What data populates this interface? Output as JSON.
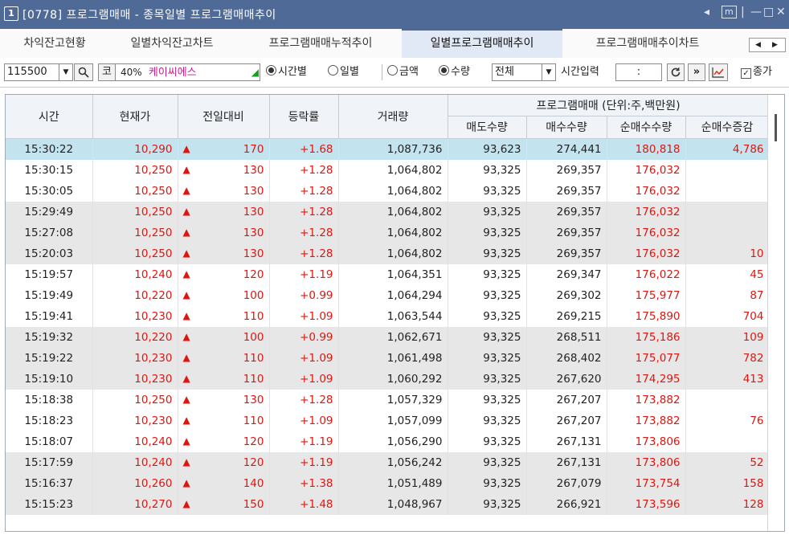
{
  "window": {
    "number": "1",
    "title": "[0778] 프로그램매매 - 종목일별 프로그램매매추이",
    "controls": [
      "◂",
      "m",
      "|",
      "—",
      "□",
      "✕"
    ]
  },
  "tabs": [
    {
      "label": "차익잔고현황",
      "active": false
    },
    {
      "label": "일별차익잔고차트",
      "active": false
    },
    {
      "label": "프로그램매매누적추이",
      "active": false
    },
    {
      "label": "일별프로그램매매추이",
      "active": true
    },
    {
      "label": "프로그램매매추이차트",
      "active": false
    }
  ],
  "tab_scroll": {
    "left": "◀",
    "right": "▶"
  },
  "toolbar": {
    "code": "115500",
    "market": "코",
    "ratio": "40%",
    "stock_name": "케이씨에스",
    "radio_time": "시간별",
    "radio_daily": "일별",
    "radio_amount": "금액",
    "radio_quantity": "수량",
    "filter": "전체",
    "time_label": "시간입력",
    "time_value": ":",
    "close_price_label": "종가"
  },
  "table": {
    "headers": {
      "time": "시간",
      "price": "현재가",
      "change": "전일대비",
      "rate": "등락률",
      "volume": "거래량",
      "program_group": "프로그램매매 (단위:주,백만원)",
      "sell_qty": "매도수량",
      "buy_qty": "매수수량",
      "net_qty": "순매수수량",
      "net_change": "순매수증감"
    },
    "rows": [
      {
        "time": "15:30:22",
        "price": "10,290",
        "arrow": "▲",
        "change": "170",
        "rate": "+1.68",
        "volume": "1,087,736",
        "sell": "93,623",
        "buy": "274,441",
        "net": "180,818",
        "delta": "4,786",
        "style": "sel"
      },
      {
        "time": "15:30:15",
        "price": "10,250",
        "arrow": "▲",
        "change": "130",
        "rate": "+1.28",
        "volume": "1,064,802",
        "sell": "93,325",
        "buy": "269,357",
        "net": "176,032",
        "delta": "",
        "style": "white"
      },
      {
        "time": "15:30:05",
        "price": "10,250",
        "arrow": "▲",
        "change": "130",
        "rate": "+1.28",
        "volume": "1,064,802",
        "sell": "93,325",
        "buy": "269,357",
        "net": "176,032",
        "delta": "",
        "style": "white"
      },
      {
        "time": "15:29:49",
        "price": "10,250",
        "arrow": "▲",
        "change": "130",
        "rate": "+1.28",
        "volume": "1,064,802",
        "sell": "93,325",
        "buy": "269,357",
        "net": "176,032",
        "delta": "",
        "style": "gray"
      },
      {
        "time": "15:27:08",
        "price": "10,250",
        "arrow": "▲",
        "change": "130",
        "rate": "+1.28",
        "volume": "1,064,802",
        "sell": "93,325",
        "buy": "269,357",
        "net": "176,032",
        "delta": "",
        "style": "gray"
      },
      {
        "time": "15:20:03",
        "price": "10,250",
        "arrow": "▲",
        "change": "130",
        "rate": "+1.28",
        "volume": "1,064,802",
        "sell": "93,325",
        "buy": "269,357",
        "net": "176,032",
        "delta": "10",
        "style": "gray"
      },
      {
        "time": "15:19:57",
        "price": "10,240",
        "arrow": "▲",
        "change": "120",
        "rate": "+1.19",
        "volume": "1,064,351",
        "sell": "93,325",
        "buy": "269,347",
        "net": "176,022",
        "delta": "45",
        "style": "white"
      },
      {
        "time": "15:19:49",
        "price": "10,220",
        "arrow": "▲",
        "change": "100",
        "rate": "+0.99",
        "volume": "1,064,294",
        "sell": "93,325",
        "buy": "269,302",
        "net": "175,977",
        "delta": "87",
        "style": "white"
      },
      {
        "time": "15:19:41",
        "price": "10,230",
        "arrow": "▲",
        "change": "110",
        "rate": "+1.09",
        "volume": "1,063,544",
        "sell": "93,325",
        "buy": "269,215",
        "net": "175,890",
        "delta": "704",
        "style": "white"
      },
      {
        "time": "15:19:32",
        "price": "10,220",
        "arrow": "▲",
        "change": "100",
        "rate": "+0.99",
        "volume": "1,062,671",
        "sell": "93,325",
        "buy": "268,511",
        "net": "175,186",
        "delta": "109",
        "style": "gray"
      },
      {
        "time": "15:19:22",
        "price": "10,230",
        "arrow": "▲",
        "change": "110",
        "rate": "+1.09",
        "volume": "1,061,498",
        "sell": "93,325",
        "buy": "268,402",
        "net": "175,077",
        "delta": "782",
        "style": "gray"
      },
      {
        "time": "15:19:10",
        "price": "10,230",
        "arrow": "▲",
        "change": "110",
        "rate": "+1.09",
        "volume": "1,060,292",
        "sell": "93,325",
        "buy": "267,620",
        "net": "174,295",
        "delta": "413",
        "style": "gray"
      },
      {
        "time": "15:18:38",
        "price": "10,250",
        "arrow": "▲",
        "change": "130",
        "rate": "+1.28",
        "volume": "1,057,329",
        "sell": "93,325",
        "buy": "267,207",
        "net": "173,882",
        "delta": "",
        "style": "white"
      },
      {
        "time": "15:18:23",
        "price": "10,230",
        "arrow": "▲",
        "change": "110",
        "rate": "+1.09",
        "volume": "1,057,099",
        "sell": "93,325",
        "buy": "267,207",
        "net": "173,882",
        "delta": "76",
        "style": "white"
      },
      {
        "time": "15:18:07",
        "price": "10,240",
        "arrow": "▲",
        "change": "120",
        "rate": "+1.19",
        "volume": "1,056,290",
        "sell": "93,325",
        "buy": "267,131",
        "net": "173,806",
        "delta": "",
        "style": "white"
      },
      {
        "time": "15:17:59",
        "price": "10,240",
        "arrow": "▲",
        "change": "120",
        "rate": "+1.19",
        "volume": "1,056,242",
        "sell": "93,325",
        "buy": "267,131",
        "net": "173,806",
        "delta": "52",
        "style": "gray"
      },
      {
        "time": "15:16:37",
        "price": "10,260",
        "arrow": "▲",
        "change": "140",
        "rate": "+1.38",
        "volume": "1,051,489",
        "sell": "93,325",
        "buy": "267,079",
        "net": "173,754",
        "delta": "158",
        "style": "gray"
      },
      {
        "time": "15:15:23",
        "price": "10,270",
        "arrow": "▲",
        "change": "150",
        "rate": "+1.48",
        "volume": "1,048,967",
        "sell": "93,325",
        "buy": "266,921",
        "net": "173,596",
        "delta": "128",
        "style": "gray"
      }
    ]
  },
  "colors": {
    "title_bar": "#4f6a96",
    "up_red": "#e1150f",
    "selected_row": "#c3e3ef",
    "gray_row": "#e7e7e7"
  }
}
